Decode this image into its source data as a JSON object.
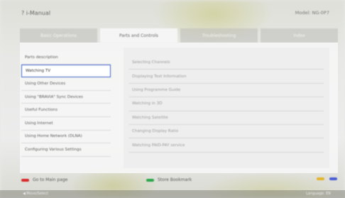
{
  "header": {
    "title": "? i-Manual",
    "model": "Model: NG-0P7"
  },
  "tabs": [
    {
      "label": "Basic Operations",
      "active": false
    },
    {
      "label": "Parts and Controls",
      "active": true
    },
    {
      "label": "Troubleshooting",
      "active": false
    },
    {
      "label": "Index",
      "active": false
    }
  ],
  "left_menu": [
    {
      "label": "Parts description",
      "selected": false
    },
    {
      "label": "Watching TV",
      "selected": true
    },
    {
      "label": "Using Other Devices",
      "selected": false
    },
    {
      "label": "Using \"BRAVIA\" Sync Devices",
      "selected": false
    },
    {
      "label": "Useful Functions",
      "selected": false
    },
    {
      "label": "Using Internet",
      "selected": false
    },
    {
      "label": "Using Home Network (DLNA)",
      "selected": false
    },
    {
      "label": "Configuring Various Settings",
      "selected": false
    }
  ],
  "right_menu": [
    {
      "label": "Selecting Channels"
    },
    {
      "label": "Displaying Text Information"
    },
    {
      "label": "Using Programme Guide"
    },
    {
      "label": "Watching in 3D"
    },
    {
      "label": "Watching Satellite"
    },
    {
      "label": "Changing Display Ratio"
    },
    {
      "label": "Watching PAID-PAY service"
    }
  ],
  "footer": {
    "red_label": "Go to Main page",
    "green_label": "Store Bookmark",
    "red_color": "#d82a2a",
    "green_color": "#2aa84a",
    "yellow_color": "#e3b52b",
    "blue_color": "#4a5cd4"
  },
  "bottom_bar": {
    "left_text": "◀ Move/Select",
    "right_text": "Language: EN"
  }
}
